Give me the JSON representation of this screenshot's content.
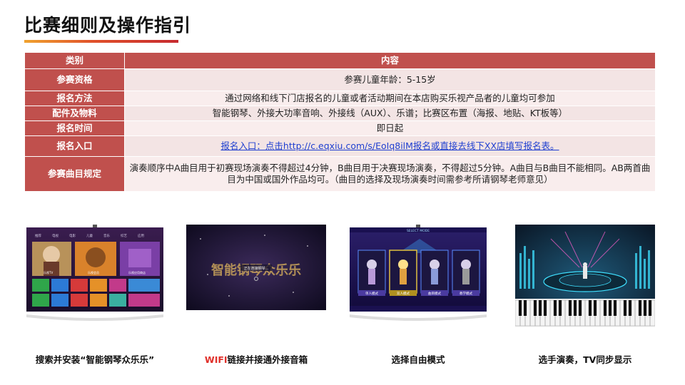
{
  "title": "比赛细则及操作指引",
  "table": {
    "headers": [
      "类别",
      "内容"
    ],
    "rows": [
      {
        "category": "参赛资格",
        "content": "参赛儿童年龄：5-15岁"
      },
      {
        "category": "报名方法",
        "content": "通过网络和线下门店报名的儿童或者活动期间在本店购买乐视产品者的儿童均可参加"
      },
      {
        "category": "配件及物料",
        "content": "智能钢琴、外接大功率音响、外接线（AUX）、乐谱；比赛区布置（海报、地贴、KT板等）"
      },
      {
        "category": "报名时间",
        "content": "即日起"
      },
      {
        "category": "报名入口",
        "content": "报名入口：点击http://c.eqxiu.com/s/EoIq8ilM报名或直接去线下XX店填写报名表。"
      },
      {
        "category": "参赛曲目规定",
        "content": "演奏顺序中A曲目用于初赛现场演奏不得超过4分钟，B曲目用于决赛现场演奏，不得超过5分钟。A曲目与B曲目不能相同。AB两首曲目为中国或国外作品均可。（曲目的选择及现场演奏时间需参考所请钢琴老师意见）"
      }
    ]
  },
  "steps": [
    {
      "caption": "搜索并安装“智能钢琴众乐乐”"
    },
    {
      "caption_highlight": "WIFI",
      "caption_rest": "链接并接通外接音箱"
    },
    {
      "caption": "选择自由模式"
    },
    {
      "caption": "选手演奏，TV同步显示"
    }
  ],
  "screens": {
    "tv_tabs": [
      "推荐",
      "电视",
      "电影",
      "儿童",
      "音乐",
      "综艺",
      "应用"
    ],
    "tv_labels": [
      "乐视TV",
      "乐视会员",
      "乐视应用商店"
    ],
    "app_logo": "智能钢琴众乐乐",
    "app_loading": "正在连接钢琴...",
    "mode_header": "SELECT MODE",
    "modes": [
      "单人模式",
      "双人模式",
      "曲目模式",
      "教学模式"
    ]
  },
  "colors": {
    "header": "#c0504d",
    "row": "#f3e4e4",
    "link": "#1f3fd0",
    "accent": "#e0302a"
  }
}
